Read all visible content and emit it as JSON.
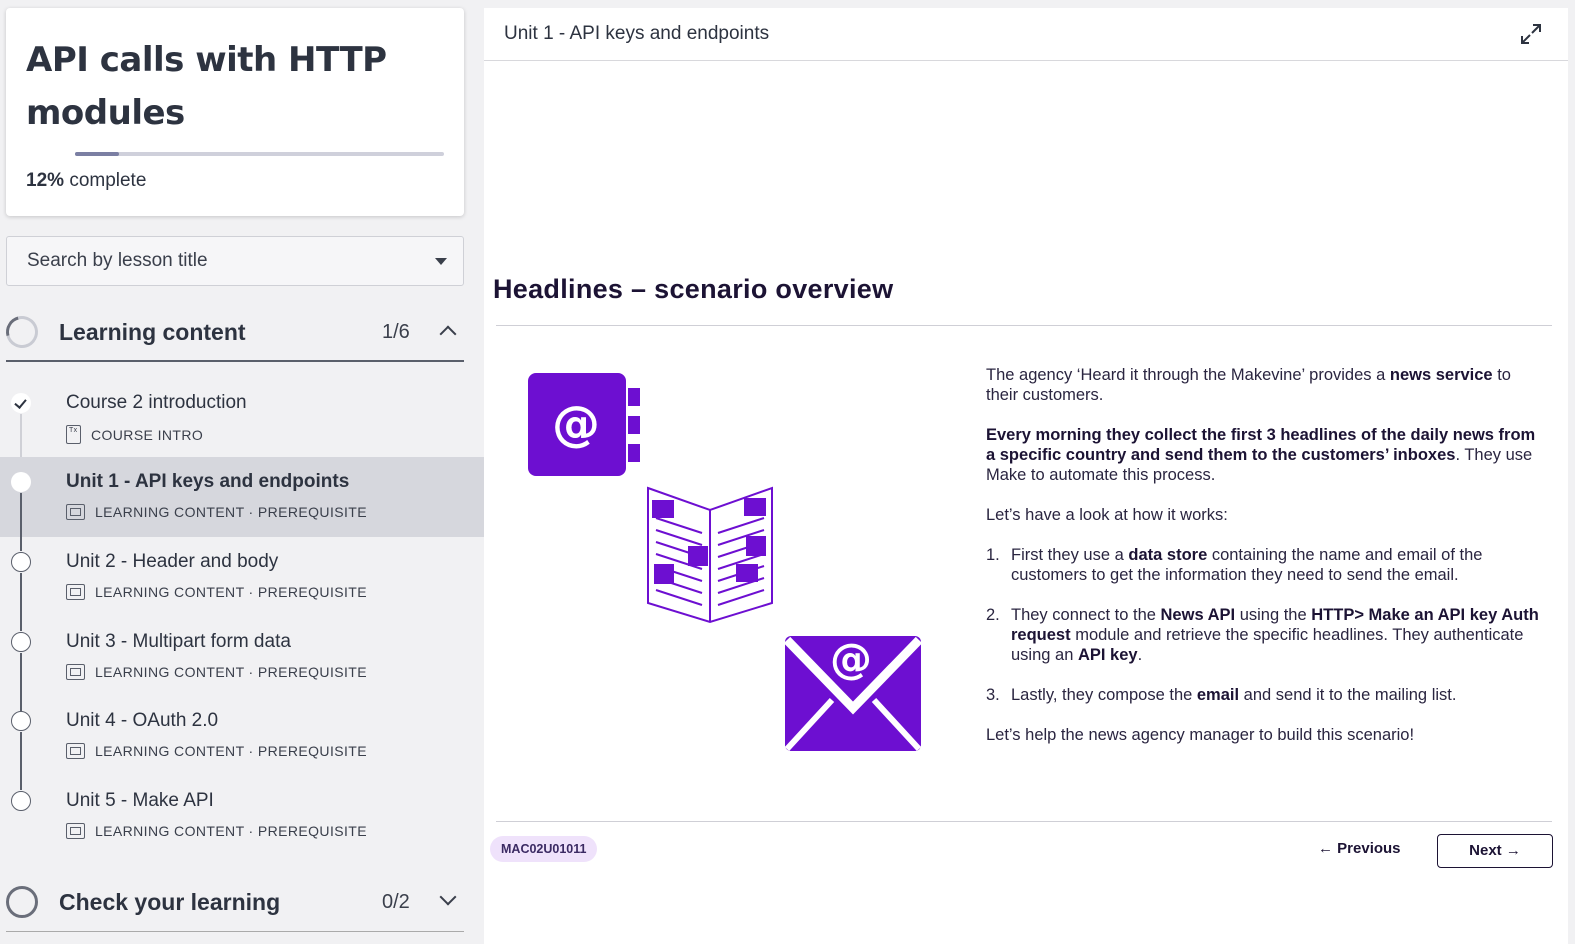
{
  "course": {
    "title": "API calls with HTTP modules",
    "progress_value": "12%",
    "progress_suffix": "complete",
    "progress_fraction": 0.12
  },
  "search": {
    "placeholder": "Search by lesson title"
  },
  "sections": [
    {
      "title": "Learning content",
      "count": "1/6",
      "expanded": true
    },
    {
      "title": "Check your learning",
      "count": "0/2",
      "expanded": false
    }
  ],
  "lessons": [
    {
      "title": "Course 2 introduction",
      "meta": "COURSE INTRO",
      "status": "complete",
      "icon": "document-icon"
    },
    {
      "title": "Unit 1 - API keys and endpoints",
      "meta": "LEARNING CONTENT · PREREQUISITE",
      "status": "current",
      "icon": "slides-icon"
    },
    {
      "title": "Unit 2 - Header and body",
      "meta": "LEARNING CONTENT · PREREQUISITE",
      "status": "not-started",
      "icon": "slides-icon"
    },
    {
      "title": "Unit 3 - Multipart form data",
      "meta": "LEARNING CONTENT · PREREQUISITE",
      "status": "not-started",
      "icon": "slides-icon"
    },
    {
      "title": "Unit 4 - OAuth 2.0",
      "meta": "LEARNING CONTENT · PREREQUISITE",
      "status": "not-started",
      "icon": "slides-icon"
    },
    {
      "title": "Unit 5 - Make API",
      "meta": "LEARNING CONTENT · PREREQUISITE",
      "status": "not-started",
      "icon": "slides-icon"
    }
  ],
  "main": {
    "unit_label": "Unit 1 - API keys and endpoints",
    "heading": "Headlines – scenario overview",
    "para1_a": "The agency ‘Heard it through the Makevine’ provides a ",
    "para1_b": "news service",
    "para1_c": " to their customers.",
    "para2_a": "Every morning they collect the first 3 headlines of the daily news from a specific country and send them to the customers’ inboxes",
    "para2_b": ". They use Make to automate this process.",
    "para3": "Let’s have a look at how it works:",
    "step1_num": "1.",
    "step1_a": "First they use a ",
    "step1_b": "data store",
    "step1_c": " containing the name and email of the customers to get the information they need to send the email.",
    "step2_num": "2.",
    "step2_a": "They connect to the ",
    "step2_b": "News API",
    "step2_c": " using the ",
    "step2_d": "HTTP> Make an API key Auth request",
    "step2_e": " module and retrieve the specific headlines. They authenticate using an ",
    "step2_f": "API key",
    "step2_g": ".",
    "step3_num": "3.",
    "step3_a": "Lastly, they compose the ",
    "step3_b": "email",
    "step3_c": " and send it to the mailing list.",
    "para4": "Let’s help the news agency manager to build this scenario!",
    "code": "MAC02U01011",
    "prev_label": "← Previous",
    "next_label": "Next →",
    "accent": "#6d0fd1"
  }
}
